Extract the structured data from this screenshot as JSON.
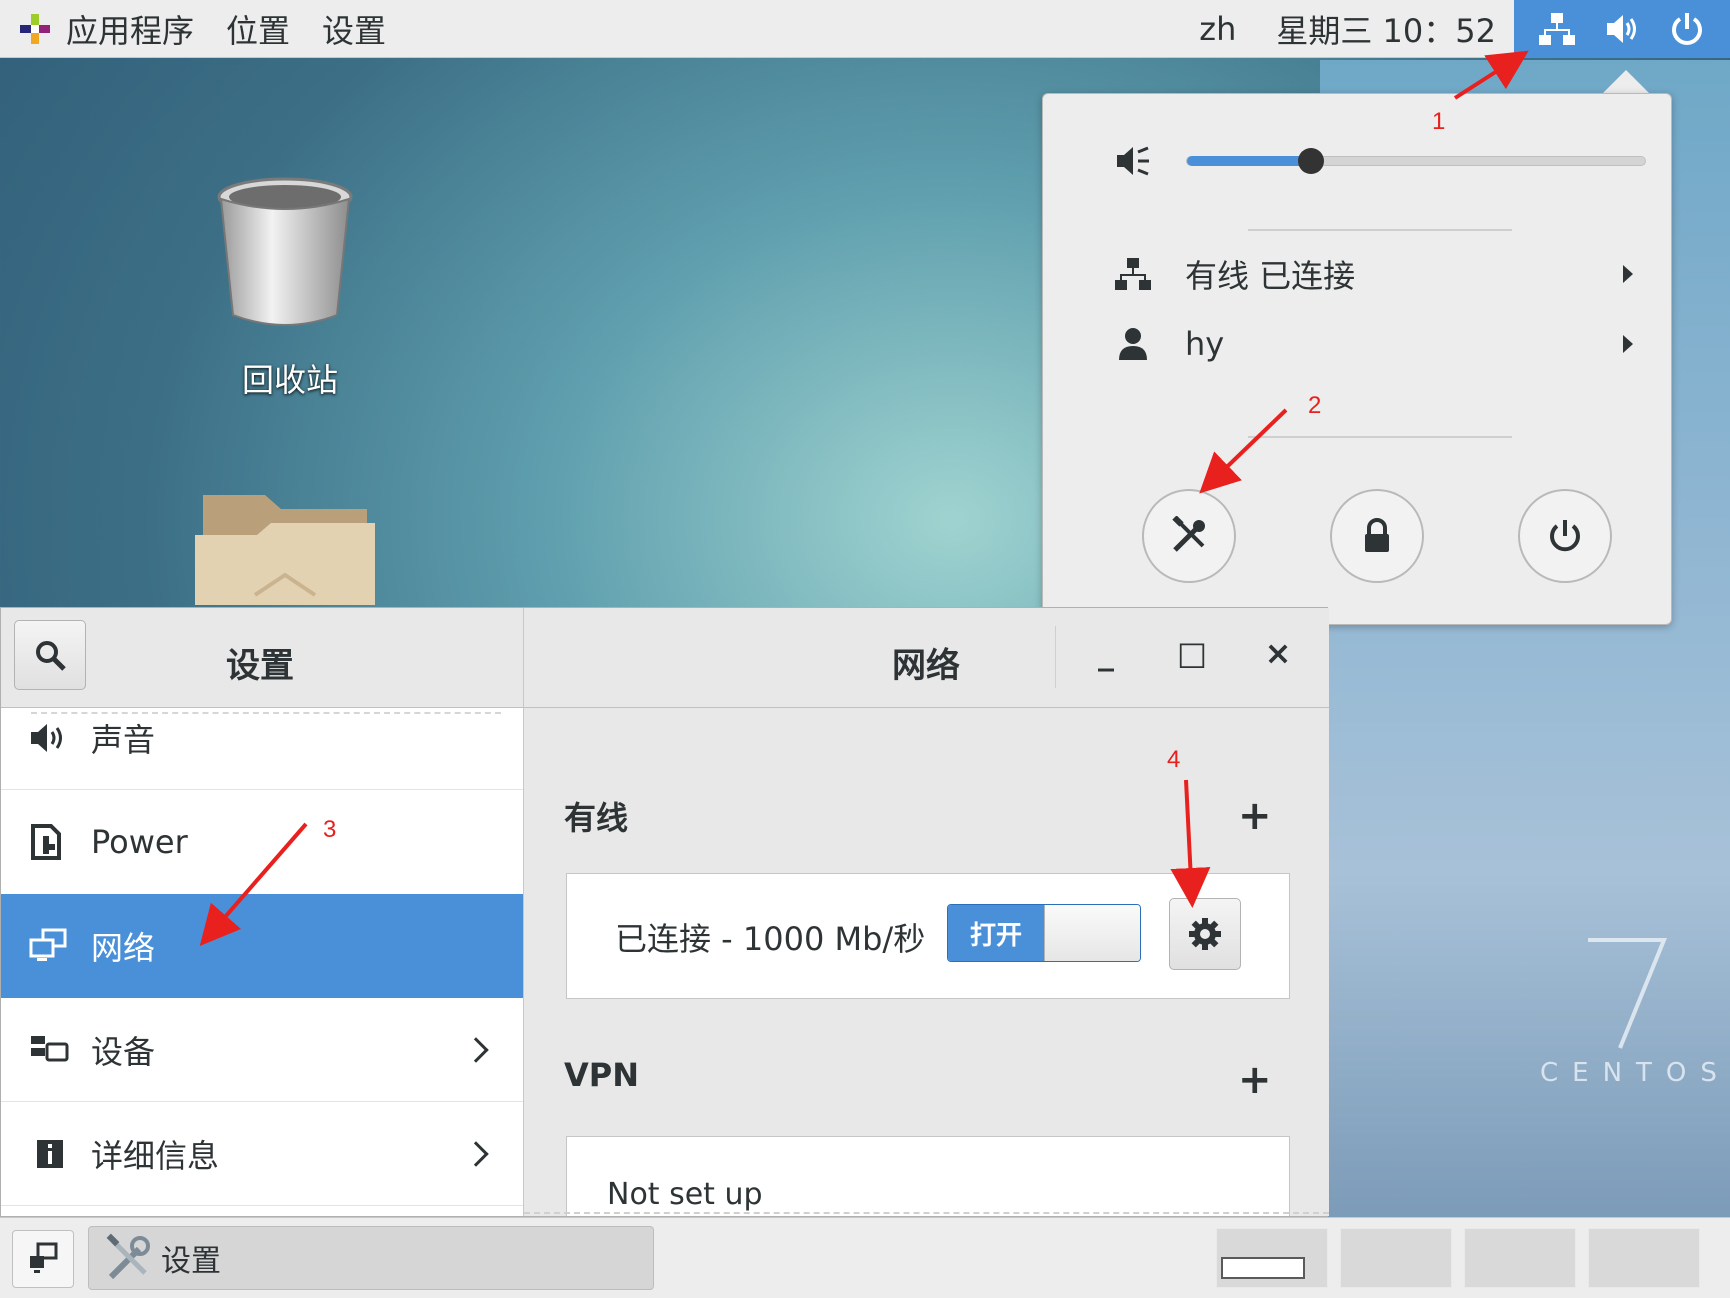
{
  "top_panel": {
    "menu": [
      "应用程序",
      "位置",
      "设置"
    ],
    "lang": "zh",
    "clock": "星期三 10：52",
    "tray_icons": [
      "network-wired-icon",
      "volume-icon",
      "power-icon"
    ]
  },
  "desktop": {
    "trash_label": "回收站",
    "watermark_number": "7",
    "watermark_text": "CENTOS"
  },
  "system_menu": {
    "volume_level": 0.27,
    "rows": [
      {
        "label": "有线 已连接",
        "icon": "network-wired-icon"
      },
      {
        "label": "hy",
        "icon": "user-icon"
      }
    ],
    "buttons": [
      "settings-icon",
      "lock-icon",
      "power-icon"
    ]
  },
  "settings_window": {
    "left_title": "设置",
    "right_title": "网络",
    "controls": {
      "minimize": "_",
      "maximize": "□",
      "close": "×"
    },
    "sidebar": [
      {
        "label": "声音",
        "icon": "speaker-icon",
        "selected": false,
        "chevron": false
      },
      {
        "label": "Power",
        "icon": "power-plug-icon",
        "selected": false,
        "chevron": false
      },
      {
        "label": "网络",
        "icon": "network-icon",
        "selected": true,
        "chevron": false
      },
      {
        "label": "设备",
        "icon": "devices-icon",
        "selected": false,
        "chevron": true
      },
      {
        "label": "详细信息",
        "icon": "info-icon",
        "selected": false,
        "chevron": true
      }
    ],
    "wired": {
      "title": "有线",
      "add": "+",
      "status": "已连接 - 1000 Mb/秒",
      "toggle_label": "打开",
      "toggle_on": true
    },
    "vpn": {
      "title": "VPN",
      "add": "+",
      "status": "Not set up"
    }
  },
  "taskbar": {
    "task_label": "设置",
    "workspaces": 4,
    "active_workspace": 1
  },
  "annotations": [
    "1",
    "2",
    "3",
    "4"
  ],
  "colors": {
    "accent": "#4a90d9",
    "annotation": "#e8201e",
    "panel": "#ededed"
  }
}
